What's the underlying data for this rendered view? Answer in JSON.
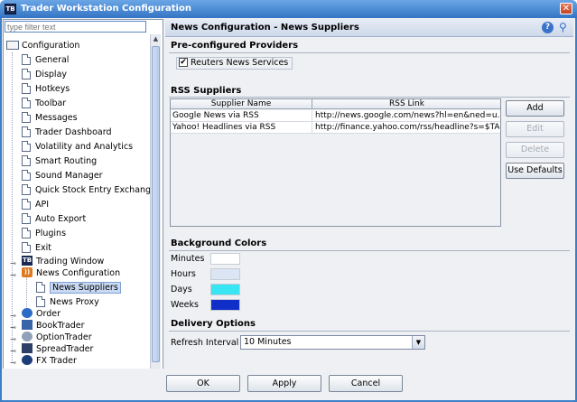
{
  "window": {
    "title": "Trader Workstation Configuration",
    "close_glyph": "✕",
    "icon_text": "TB"
  },
  "sidebar": {
    "filter_placeholder": "type filter text",
    "root": "Configuration",
    "items": [
      {
        "label": "General"
      },
      {
        "label": "Display"
      },
      {
        "label": "Hotkeys"
      },
      {
        "label": "Toolbar"
      },
      {
        "label": "Messages"
      },
      {
        "label": "Trader Dashboard"
      },
      {
        "label": "Volatility and Analytics"
      },
      {
        "label": "Smart Routing"
      },
      {
        "label": "Sound Manager"
      },
      {
        "label": "Quick Stock Entry Exchanges"
      },
      {
        "label": "API"
      },
      {
        "label": "Auto Export"
      },
      {
        "label": "Plugins"
      },
      {
        "label": "Exit"
      }
    ],
    "trading_window": "Trading Window",
    "news_config": "News Configuration",
    "news_suppliers": "News Suppliers",
    "news_proxy": "News Proxy",
    "groups": [
      {
        "label": "Order"
      },
      {
        "label": "BookTrader"
      },
      {
        "label": "OptionTrader"
      },
      {
        "label": "SpreadTrader"
      },
      {
        "label": "FX Trader"
      }
    ]
  },
  "header": {
    "title": "News Configuration - News Suppliers",
    "help": "?"
  },
  "providers": {
    "title": "Pre-configured Providers",
    "reuters_label": "Reuters News Services",
    "reuters_checked": true,
    "check_glyph": "✔"
  },
  "rss": {
    "title": "RSS Suppliers",
    "columns": [
      "Supplier Name",
      "RSS Link"
    ],
    "rows": [
      {
        "name": "Google News via RSS",
        "link": "http://news.google.com/news?hl=en&ned=u..."
      },
      {
        "name": "Yahoo! Headlines via RSS",
        "link": "http://finance.yahoo.com/rss/headline?s=$TAG"
      }
    ],
    "buttons": {
      "add": "Add",
      "edit": "Edit",
      "delete": "Delete",
      "defaults": "Use Defaults"
    }
  },
  "background_colors": {
    "title": "Background Colors",
    "items": [
      {
        "label": "Minutes",
        "color": "#ffffff"
      },
      {
        "label": "Hours",
        "color": "#dce5f3"
      },
      {
        "label": "Days",
        "color": "#38e5f2"
      },
      {
        "label": "Weeks",
        "color": "#0f2fc8"
      }
    ]
  },
  "delivery": {
    "title": "Delivery Options",
    "refresh_label": "Refresh Interval",
    "refresh_value": "10 Minutes"
  },
  "footer": {
    "ok": "OK",
    "apply": "Apply",
    "cancel": "Cancel"
  }
}
